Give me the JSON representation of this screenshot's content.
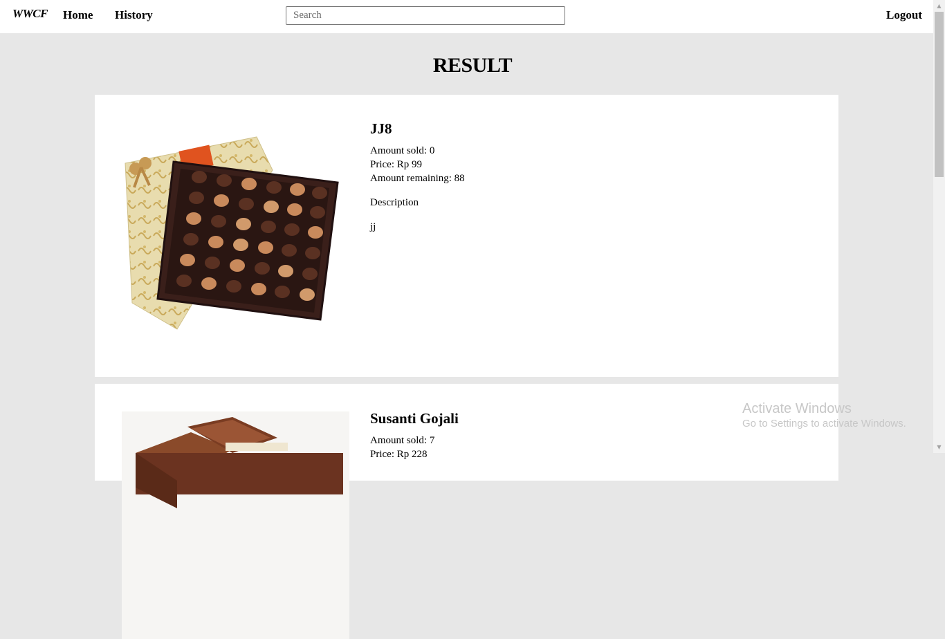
{
  "navbar": {
    "brand": "WWCF",
    "home_label": "Home",
    "history_label": "History",
    "search_placeholder": "Search",
    "logout_label": "Logout"
  },
  "page": {
    "title": "RESULT"
  },
  "products": [
    {
      "name": "JJ8",
      "amount_sold": "Amount sold: 0",
      "price": "Price: Rp 99",
      "amount_remaining": "Amount remaining: 88",
      "description_label": "Description",
      "description": "jj"
    },
    {
      "name": "Susanti Gojali",
      "amount_sold": "Amount sold: 7",
      "price": "Price: Rp 228"
    }
  ],
  "watermark": {
    "title": "Activate Windows",
    "subtitle": "Go to Settings to activate Windows."
  },
  "colors": {
    "background": "#e7e7e7",
    "card": "#ffffff",
    "navbar": "#ffffff"
  }
}
